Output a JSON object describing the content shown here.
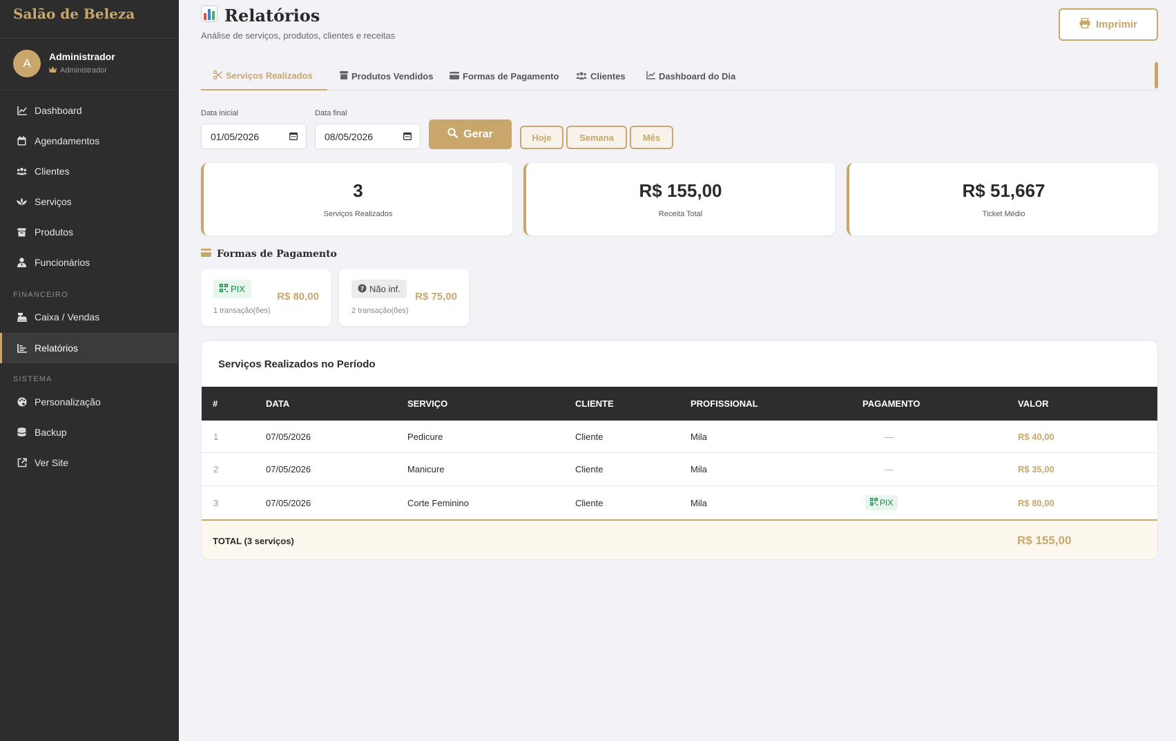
{
  "colors": {
    "accent": "#c9a66b",
    "sidebar_bg": "#2d2d2d",
    "page_bg": "#f3f3f7",
    "pix_green": "#1a8a47"
  },
  "sidebar": {
    "brand": "Salão de Beleza",
    "user": {
      "initial": "A",
      "name": "Administrador",
      "role": "Administrador"
    },
    "items": [
      {
        "label": "Dashboard",
        "icon": "chart-line-icon"
      },
      {
        "label": "Agendamentos",
        "icon": "calendar-icon"
      },
      {
        "label": "Clientes",
        "icon": "users-icon"
      },
      {
        "label": "Serviços",
        "icon": "spa-icon"
      },
      {
        "label": "Produtos",
        "icon": "box-icon"
      },
      {
        "label": "Funcionários",
        "icon": "user-tie-icon"
      }
    ],
    "section_financeiro": "FINANCEIRO",
    "financeiro_items": [
      {
        "label": "Caixa / Vendas",
        "icon": "cash-register-icon"
      },
      {
        "label": "Relatórios",
        "icon": "report-icon",
        "active": true
      }
    ],
    "section_sistema": "SISTEMA",
    "sistema_items": [
      {
        "label": "Personalização",
        "icon": "palette-icon"
      },
      {
        "label": "Backup",
        "icon": "database-icon"
      },
      {
        "label": "Ver Site",
        "icon": "external-link-icon"
      }
    ]
  },
  "header": {
    "title": "Relatórios",
    "subtitle": "Análise de serviços, produtos, clientes e receitas",
    "print_label": "Imprimir"
  },
  "tabs": [
    {
      "label": "Serviços Realizados",
      "icon": "scissors-icon",
      "active": true
    },
    {
      "label": "Produtos Vendidos",
      "icon": "box-icon"
    },
    {
      "label": "Formas de Pagamento",
      "icon": "credit-card-icon"
    },
    {
      "label": "Clientes",
      "icon": "users-icon"
    },
    {
      "label": "Dashboard do Dia",
      "icon": "chart-line-icon"
    }
  ],
  "filters": {
    "start_label": "Data inicial",
    "start_value": "01/05/2026",
    "end_label": "Data final",
    "end_value": "08/05/2026",
    "generate_label": "Gerar",
    "quick": [
      "Hoje",
      "Semana",
      "Mês"
    ]
  },
  "stats": [
    {
      "value": "3",
      "label": "Serviços Realizados"
    },
    {
      "value": "R$ 155,00",
      "label": "Receita Total"
    },
    {
      "value": "R$ 51,667",
      "label": "Ticket Médio"
    }
  ],
  "payments": {
    "title": "Formas de Pagamento",
    "cards": [
      {
        "method": "PIX",
        "amount": "R$ 80,00",
        "count": "1 transação(ões)"
      },
      {
        "method": "Não inf.",
        "amount": "R$ 75,00",
        "count": "2 transação(ões)"
      }
    ]
  },
  "table": {
    "title": "Serviços Realizados no Período",
    "columns": [
      "#",
      "DATA",
      "SERVIÇO",
      "CLIENTE",
      "PROFISSIONAL",
      "PAGAMENTO",
      "VALOR"
    ],
    "rows": [
      [
        "1",
        "07/05/2026",
        "Pedicure",
        "Cliente",
        "Mila",
        "—",
        "R$ 40,00"
      ],
      [
        "2",
        "07/05/2026",
        "Manicure",
        "Cliente",
        "Mila",
        "—",
        "R$ 35,00"
      ],
      [
        "3",
        "07/05/2026",
        "Corte Feminino",
        "Cliente",
        "Mila",
        "PIX",
        "R$ 80,00"
      ]
    ],
    "total_label": "TOTAL (3 serviços)",
    "total_value": "R$ 155,00"
  }
}
